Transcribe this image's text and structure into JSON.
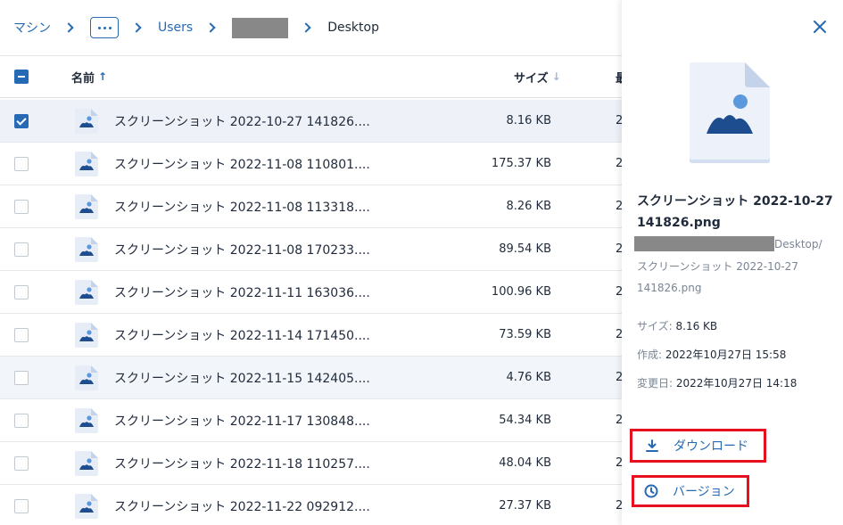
{
  "breadcrumb": {
    "root": "マシン",
    "more": "…",
    "users": "Users",
    "current": "Desktop"
  },
  "list": {
    "columns": {
      "name": "名前",
      "size": "サイズ",
      "modified": "最"
    },
    "rows": [
      {
        "name": "スクリーンショット 2022-10-27 141826....",
        "size": "8.16 KB",
        "date": "2",
        "checked": true
      },
      {
        "name": "スクリーンショット 2022-11-08 110801....",
        "size": "175.37 KB",
        "date": "2"
      },
      {
        "name": "スクリーンショット 2022-11-08 113318....",
        "size": "8.26 KB",
        "date": "2"
      },
      {
        "name": "スクリーンショット 2022-11-08 170233....",
        "size": "89.54 KB",
        "date": "2"
      },
      {
        "name": "スクリーンショット 2022-11-11 163036....",
        "size": "100.96 KB",
        "date": "2"
      },
      {
        "name": "スクリーンショット 2022-11-14 171450....",
        "size": "73.59 KB",
        "date": "2"
      },
      {
        "name": "スクリーンショット 2022-11-15 142405....",
        "size": "4.76 KB",
        "date": "2"
      },
      {
        "name": "スクリーンショット 2022-11-17 130848....",
        "size": "54.34 KB",
        "date": "2"
      },
      {
        "name": "スクリーンショット 2022-11-18 110257....",
        "size": "48.04 KB",
        "date": "2"
      },
      {
        "name": "スクリーンショット 2022-11-22 092912....",
        "size": "27.37 KB",
        "date": "2"
      }
    ]
  },
  "panel": {
    "title": "スクリーンショット 2022-10-27 141826.png",
    "path_suffix": "Desktop/",
    "path_rest": "スクリーンショット 2022-10-27 141826.png",
    "size_label": "サイズ:",
    "size_value": "8.16 KB",
    "created_label": "作成:",
    "created_value": "2022年10月27日 15:58",
    "modified_label": "変更日:",
    "modified_value": "2022年10月27日 14:18",
    "download_label": "ダウンロード",
    "version_label": "バージョン"
  },
  "colors": {
    "accent": "#2669b5",
    "highlight_border": "#e8101e",
    "selected_row": "#eef2f8"
  },
  "icons": {
    "close": "close-icon",
    "file": "image-file-icon",
    "download": "download-icon",
    "version": "clock-icon"
  }
}
